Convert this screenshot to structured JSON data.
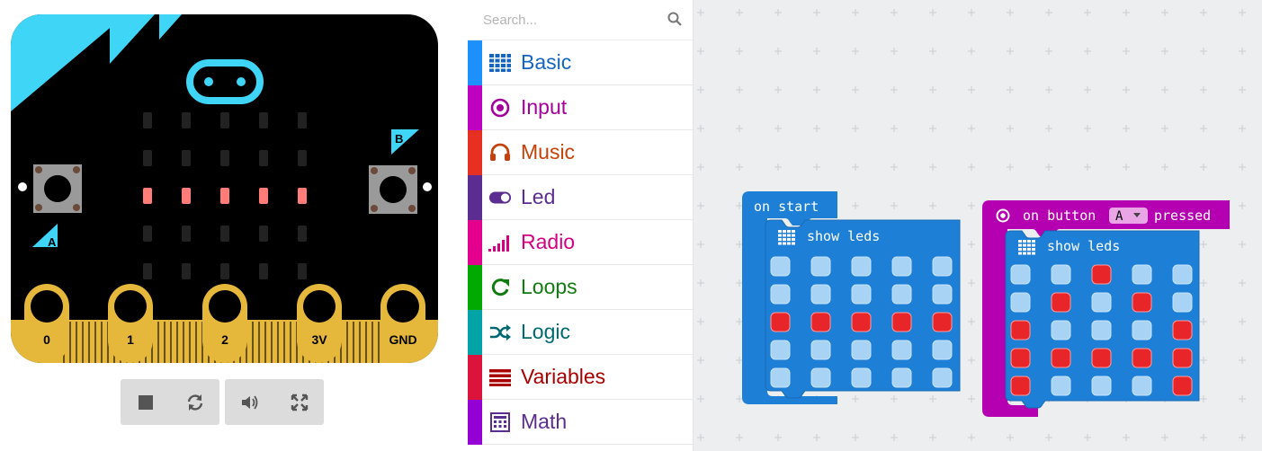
{
  "simulator": {
    "pin_labels": [
      "0",
      "1",
      "2",
      "3V",
      "GND"
    ],
    "button_labels": {
      "a": "A",
      "b": "B"
    },
    "leds": [
      [
        0,
        0,
        0,
        0,
        0
      ],
      [
        0,
        0,
        0,
        0,
        0
      ],
      [
        1,
        1,
        1,
        1,
        1
      ],
      [
        0,
        0,
        0,
        0,
        0
      ],
      [
        0,
        0,
        0,
        0,
        0
      ]
    ],
    "controls": [
      "stop-icon",
      "restart-icon",
      "sound-icon",
      "fullscreen-icon"
    ]
  },
  "toolbox": {
    "search_placeholder": "Search...",
    "categories": [
      {
        "label": "Basic",
        "color": "#1e90ff",
        "text_color": "#1565c0",
        "icon": "grid-icon"
      },
      {
        "label": "Input",
        "color": "#c000c0",
        "text_color": "#a4009c",
        "icon": "target-icon"
      },
      {
        "label": "Music",
        "color": "#e63022",
        "text_color": "#c6410a",
        "icon": "headphones-icon"
      },
      {
        "label": "Led",
        "color": "#5c2d91",
        "text_color": "#5c2d91",
        "icon": "toggle-icon"
      },
      {
        "label": "Radio",
        "color": "#e3008c",
        "text_color": "#d4007f",
        "icon": "signal-icon"
      },
      {
        "label": "Loops",
        "color": "#00aa00",
        "text_color": "#107c10",
        "icon": "loop-icon"
      },
      {
        "label": "Logic",
        "color": "#00a4a6",
        "text_color": "#006970",
        "icon": "shuffle-icon"
      },
      {
        "label": "Variables",
        "color": "#dc143c",
        "text_color": "#a80000",
        "icon": "list-icon"
      },
      {
        "label": "Math",
        "color": "#9400d3",
        "text_color": "#5c2d91",
        "icon": "calculator-icon"
      }
    ]
  },
  "blocks": {
    "on_start": {
      "label": "on start",
      "inner_label": "show leds",
      "leds": [
        [
          0,
          0,
          0,
          0,
          0
        ],
        [
          0,
          0,
          0,
          0,
          0
        ],
        [
          1,
          1,
          1,
          1,
          1
        ],
        [
          0,
          0,
          0,
          0,
          0
        ],
        [
          0,
          0,
          0,
          0,
          0
        ]
      ]
    },
    "on_button": {
      "label_prefix": "on button",
      "button_value": "A",
      "label_suffix": "pressed",
      "inner_label": "show leds",
      "leds": [
        [
          0,
          0,
          1,
          0,
          0
        ],
        [
          0,
          1,
          0,
          1,
          0
        ],
        [
          1,
          0,
          0,
          0,
          1
        ],
        [
          1,
          1,
          1,
          1,
          1
        ],
        [
          1,
          0,
          0,
          0,
          1
        ]
      ]
    }
  },
  "colors": {
    "basic_block": "#1e7fd6",
    "input_block": "#b400b0",
    "led_on": "#e8262a",
    "led_off": "#a9d3f5",
    "board": "#000000",
    "accent": "#3ed5f7",
    "gold": "#e5b73b"
  }
}
